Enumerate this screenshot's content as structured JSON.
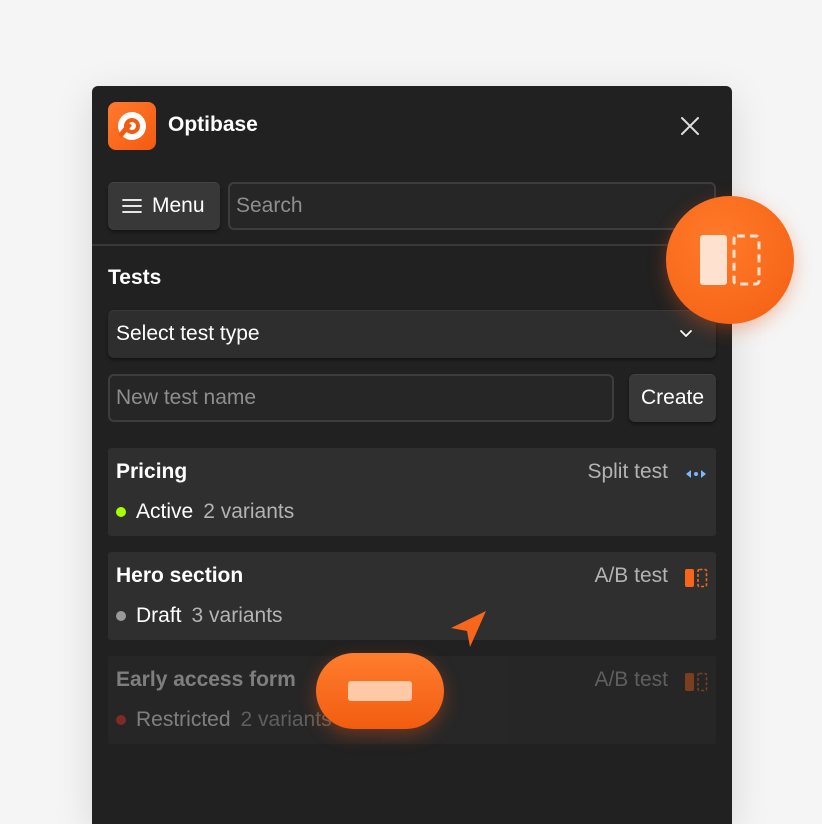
{
  "app": {
    "title": "Optibase"
  },
  "toolbar": {
    "menu_label": "Menu",
    "search_placeholder": "Search"
  },
  "tests": {
    "section_title": "Tests",
    "select_label": "Select test type",
    "new_name_placeholder": "New test name",
    "create_label": "Create",
    "items": [
      {
        "name": "Pricing",
        "type": "Split test",
        "status": "Active",
        "status_color": "#a6ff00",
        "variants": "2 variants",
        "icon": "split-test-icon"
      },
      {
        "name": "Hero section",
        "type": "A/B test",
        "status": "Draft",
        "status_color": "#9a9a9a",
        "variants": "3 variants",
        "icon": "ab-test-icon"
      },
      {
        "name": "Early access form",
        "type": "A/B test",
        "status": "Restricted",
        "status_color": "#ff3b30",
        "variants": "2 variants",
        "icon": "ab-test-icon"
      }
    ]
  },
  "colors": {
    "accent": "#f7661a",
    "panel_bg": "#212121",
    "card_bg": "#2f2f2f",
    "split_icon": "#7ab8ff"
  }
}
